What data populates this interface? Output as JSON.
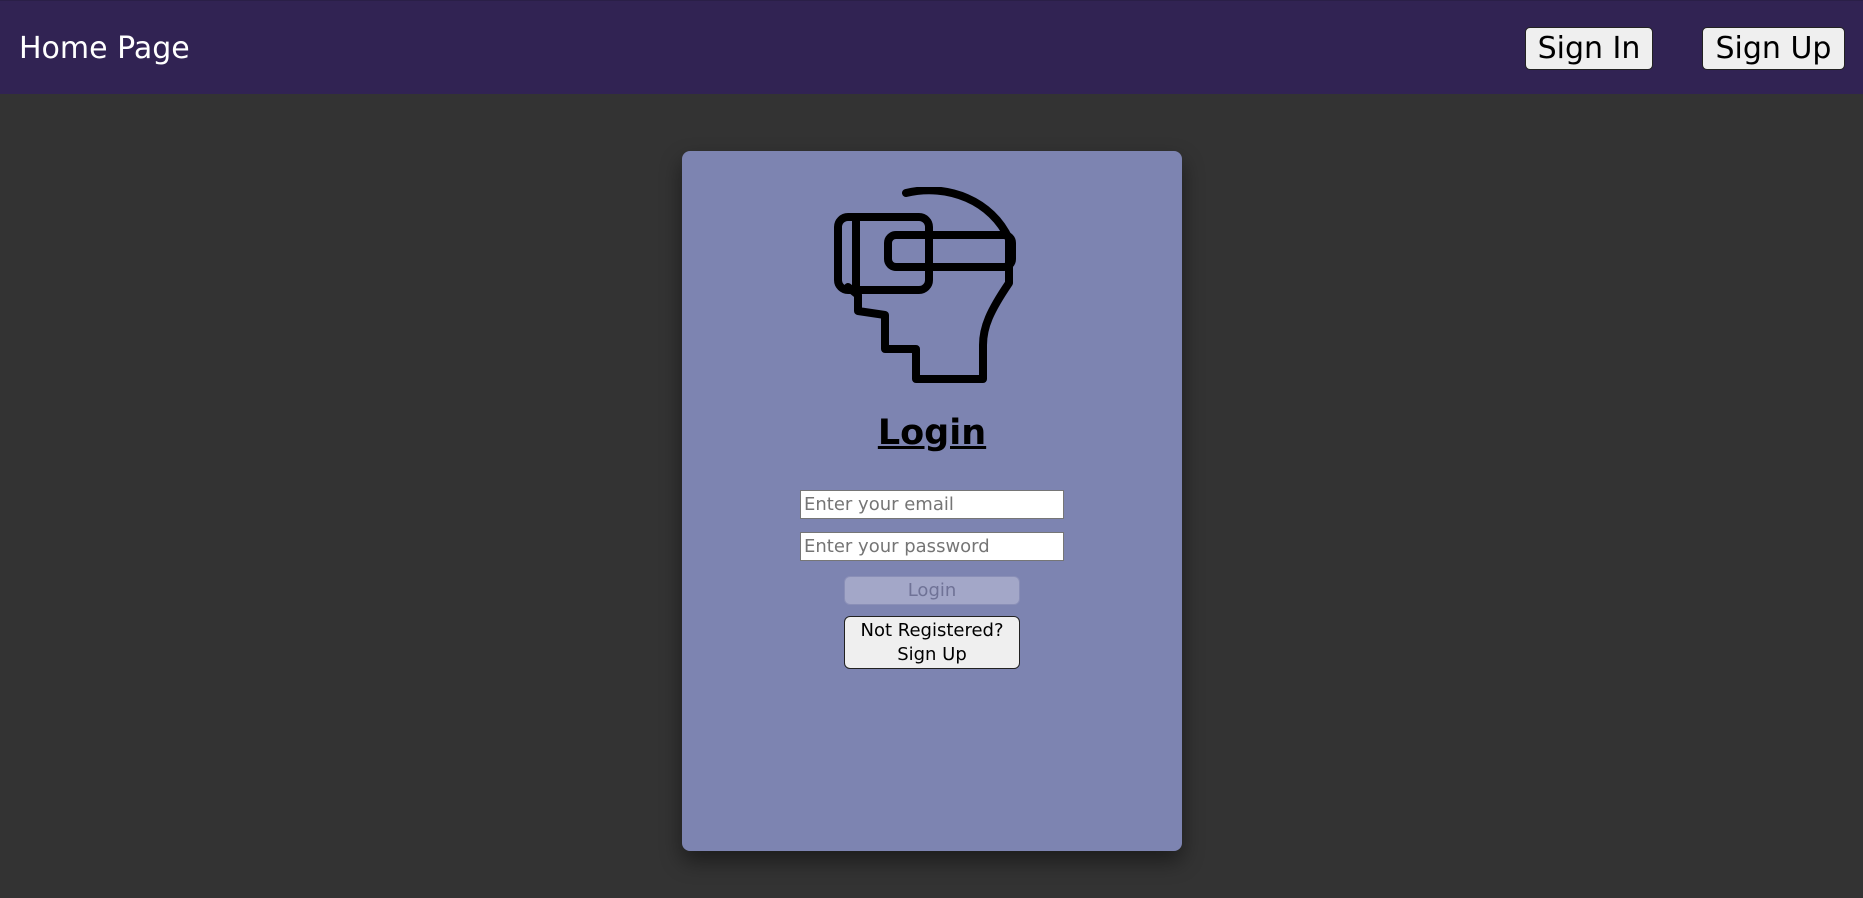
{
  "header": {
    "title": "Home Page",
    "sign_in_label": "Sign In",
    "sign_up_label": "Sign Up"
  },
  "login_card": {
    "logo_icon": "vr-headset-head-icon",
    "title": "Login",
    "email_placeholder": "Enter your email",
    "email_value": "",
    "password_placeholder": "Enter your password",
    "password_value": "",
    "login_label": "Login",
    "register_label": "Not Registered?\nSign Up"
  },
  "colors": {
    "header_bg": "#312353",
    "page_bg": "#333333",
    "card_bg": "#7d84b1",
    "disabled_button_bg": "#a3a7c8"
  }
}
